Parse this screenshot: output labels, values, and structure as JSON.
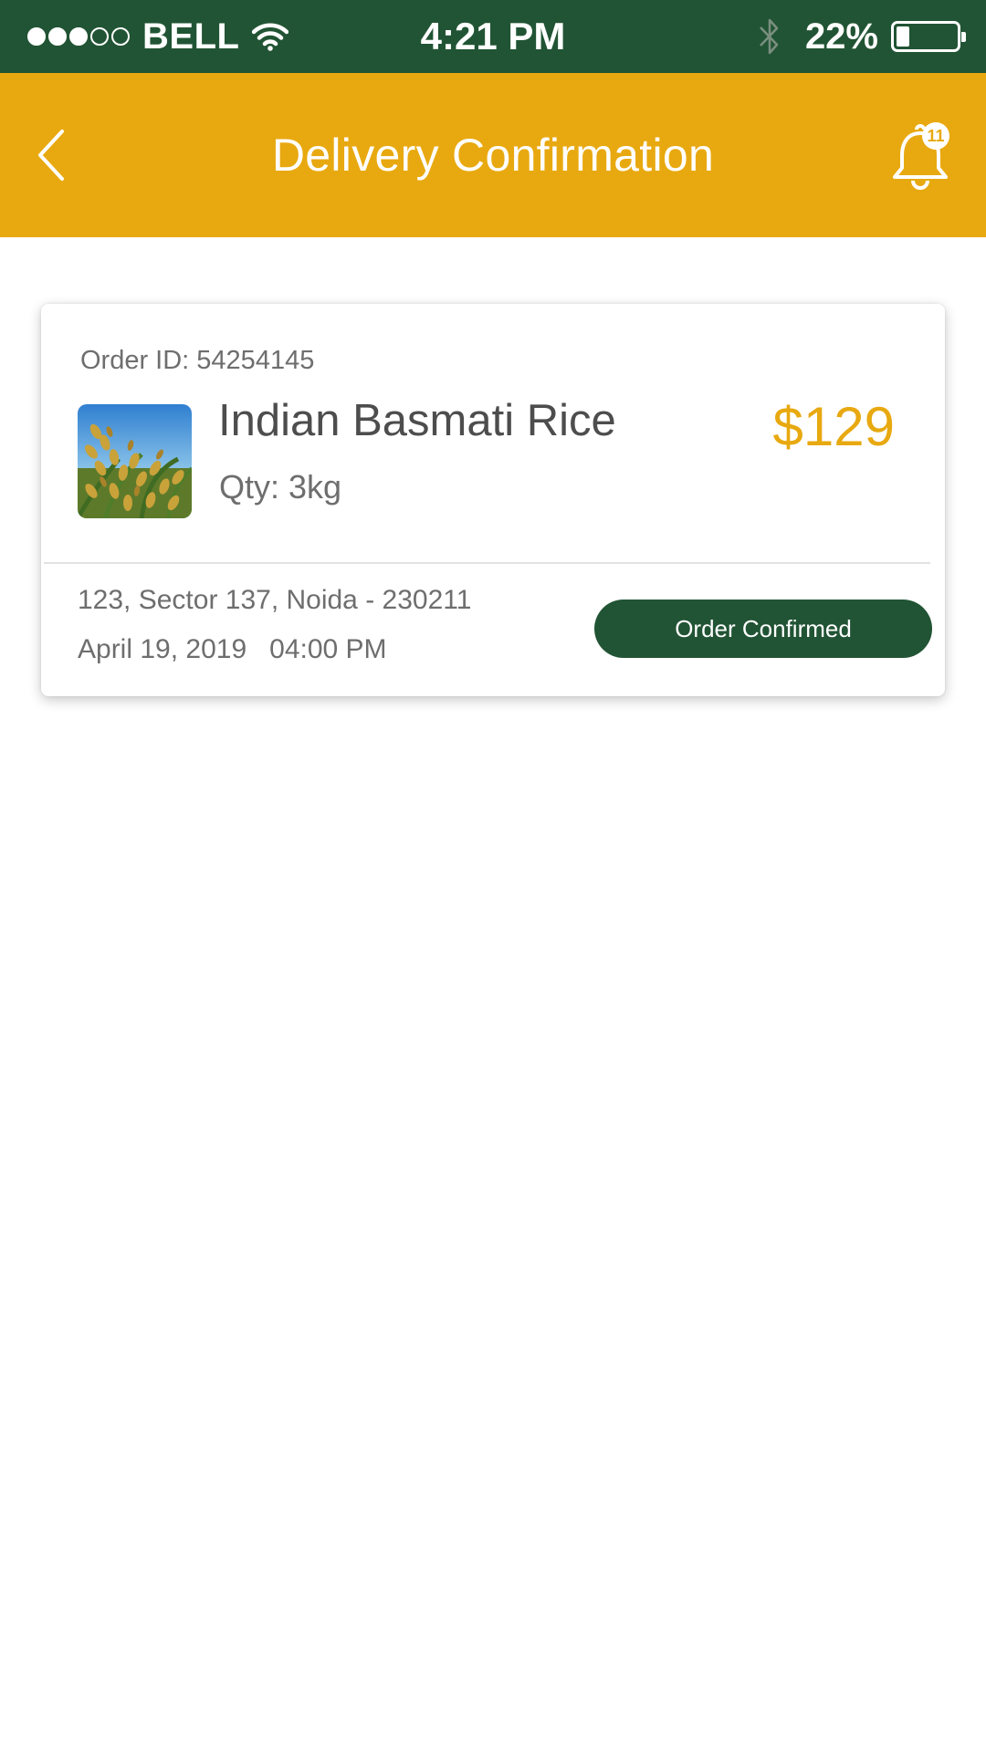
{
  "status_bar": {
    "carrier": "BELL",
    "time": "4:21 PM",
    "battery_percent": "22%",
    "battery_level": 0.22,
    "signal_strength": 3,
    "signal_total": 5,
    "icons": [
      "signal-dots-icon",
      "wifi-icon",
      "bluetooth-icon",
      "battery-icon"
    ]
  },
  "header": {
    "title": "Delivery Confirmation",
    "notification_count": "11",
    "icons": [
      "back-chevron-icon",
      "bell-icon"
    ]
  },
  "order": {
    "order_id": "Order ID: 54254145",
    "product_name": "Indian Basmati Rice",
    "quantity": "Qty: 3kg",
    "price": "$129",
    "address": "123, Sector 137, Noida - 230211",
    "datetime": "April 19, 2019   04:00 PM",
    "status_label": "Order Confirmed"
  },
  "colors": {
    "status_bar_bg": "#215434",
    "header_bg": "#e8a910",
    "accent_price": "#e8a910",
    "button_bg": "#215434"
  }
}
